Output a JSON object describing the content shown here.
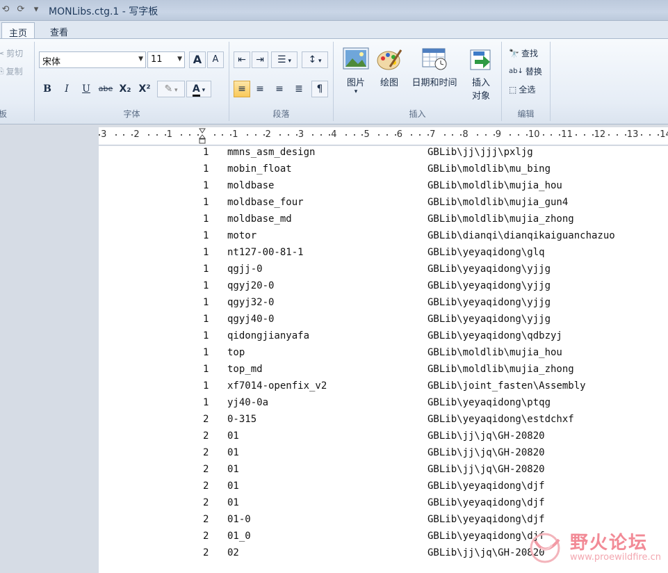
{
  "window": {
    "title": "MONLibs.ctg.1 - 写字板",
    "qat": [
      "⟲",
      "⟳",
      "▾"
    ]
  },
  "tabs": [
    {
      "label": "主页",
      "active": true
    },
    {
      "label": "查看",
      "active": false
    }
  ],
  "ribbon": {
    "clipboard": {
      "label": "板",
      "cut": "剪切",
      "copy": "复制"
    },
    "font": {
      "label": "字体",
      "family": "宋体",
      "size": "11",
      "grow": "A",
      "shrink": "A",
      "bold": "B",
      "italic": "I",
      "underline": "U",
      "strike": "abe",
      "subscript": "X₂",
      "superscript": "X²",
      "highlight": "✎",
      "color": "A"
    },
    "paragraph": {
      "label": "段落"
    },
    "insert": {
      "label": "插入",
      "picture": "图片",
      "paint": "绘图",
      "datetime": "日期和时间",
      "object_line1": "插入",
      "object_line2": "对象"
    },
    "editing": {
      "label": "编辑",
      "find": "查找",
      "replace": "替换",
      "select_all": "全选"
    }
  },
  "ruler": {
    "labels": [
      "3",
      "2",
      "1",
      "1",
      "2",
      "3",
      "4",
      "5",
      "6",
      "7",
      "8",
      "9",
      "10",
      "11",
      "12",
      "13",
      "14"
    ]
  },
  "document": {
    "rows": [
      [
        "1",
        "mmns_asm_design",
        "GBLib\\jj\\jjj\\pxljg"
      ],
      [
        "1",
        "mobin_float",
        "GBLib\\moldlib\\mu_bing"
      ],
      [
        "1",
        "moldbase",
        "GBLib\\moldlib\\mujia_hou"
      ],
      [
        "1",
        "moldbase_four",
        "GBLib\\moldlib\\mujia_gun4"
      ],
      [
        "1",
        "moldbase_md",
        "GBLib\\moldlib\\mujia_zhong"
      ],
      [
        "1",
        "motor",
        "GBLib\\dianqi\\dianqikaiguanchazuo"
      ],
      [
        "1",
        "nt127-00-81-1",
        "GBLib\\yeyaqidong\\glq"
      ],
      [
        "1",
        "qgjj-0",
        "GBLib\\yeyaqidong\\yjjg"
      ],
      [
        "1",
        "qgyj20-0",
        "GBLib\\yeyaqidong\\yjjg"
      ],
      [
        "1",
        "qgyj32-0",
        "GBLib\\yeyaqidong\\yjjg"
      ],
      [
        "1",
        "qgyj40-0",
        "GBLib\\yeyaqidong\\yjjg"
      ],
      [
        "1",
        "qidongjianyafa",
        "GBLib\\yeyaqidong\\qdbzyj"
      ],
      [
        "1",
        "top",
        "GBLib\\moldlib\\mujia_hou"
      ],
      [
        "1",
        "top_md",
        "GBLib\\moldlib\\mujia_zhong"
      ],
      [
        "1",
        "xf7014-openfix_v2",
        "GBLib\\joint_fasten\\Assembly"
      ],
      [
        "1",
        "yj40-0a",
        "GBLib\\yeyaqidong\\ptqg"
      ],
      [
        "2",
        "0-315",
        "GBLib\\yeyaqidong\\estdchxf"
      ],
      [
        "2",
        "01",
        "GBLib\\jj\\jq\\GH-20820"
      ],
      [
        "2",
        "01",
        "GBLib\\jj\\jq\\GH-20820"
      ],
      [
        "2",
        "01",
        "GBLib\\jj\\jq\\GH-20820"
      ],
      [
        "2",
        "01",
        "GBLib\\yeyaqidong\\djf"
      ],
      [
        "2",
        "01",
        "GBLib\\yeyaqidong\\djf"
      ],
      [
        "2",
        "01-0",
        "GBLib\\yeyaqidong\\djf"
      ],
      [
        "2",
        "01_0",
        "GBLib\\yeyaqidong\\djf"
      ],
      [
        "2",
        "02",
        "GBLib\\jj\\jq\\GH-20820"
      ]
    ]
  },
  "watermark": {
    "text": "野火论坛",
    "url": "www.proewildfire.cn"
  }
}
